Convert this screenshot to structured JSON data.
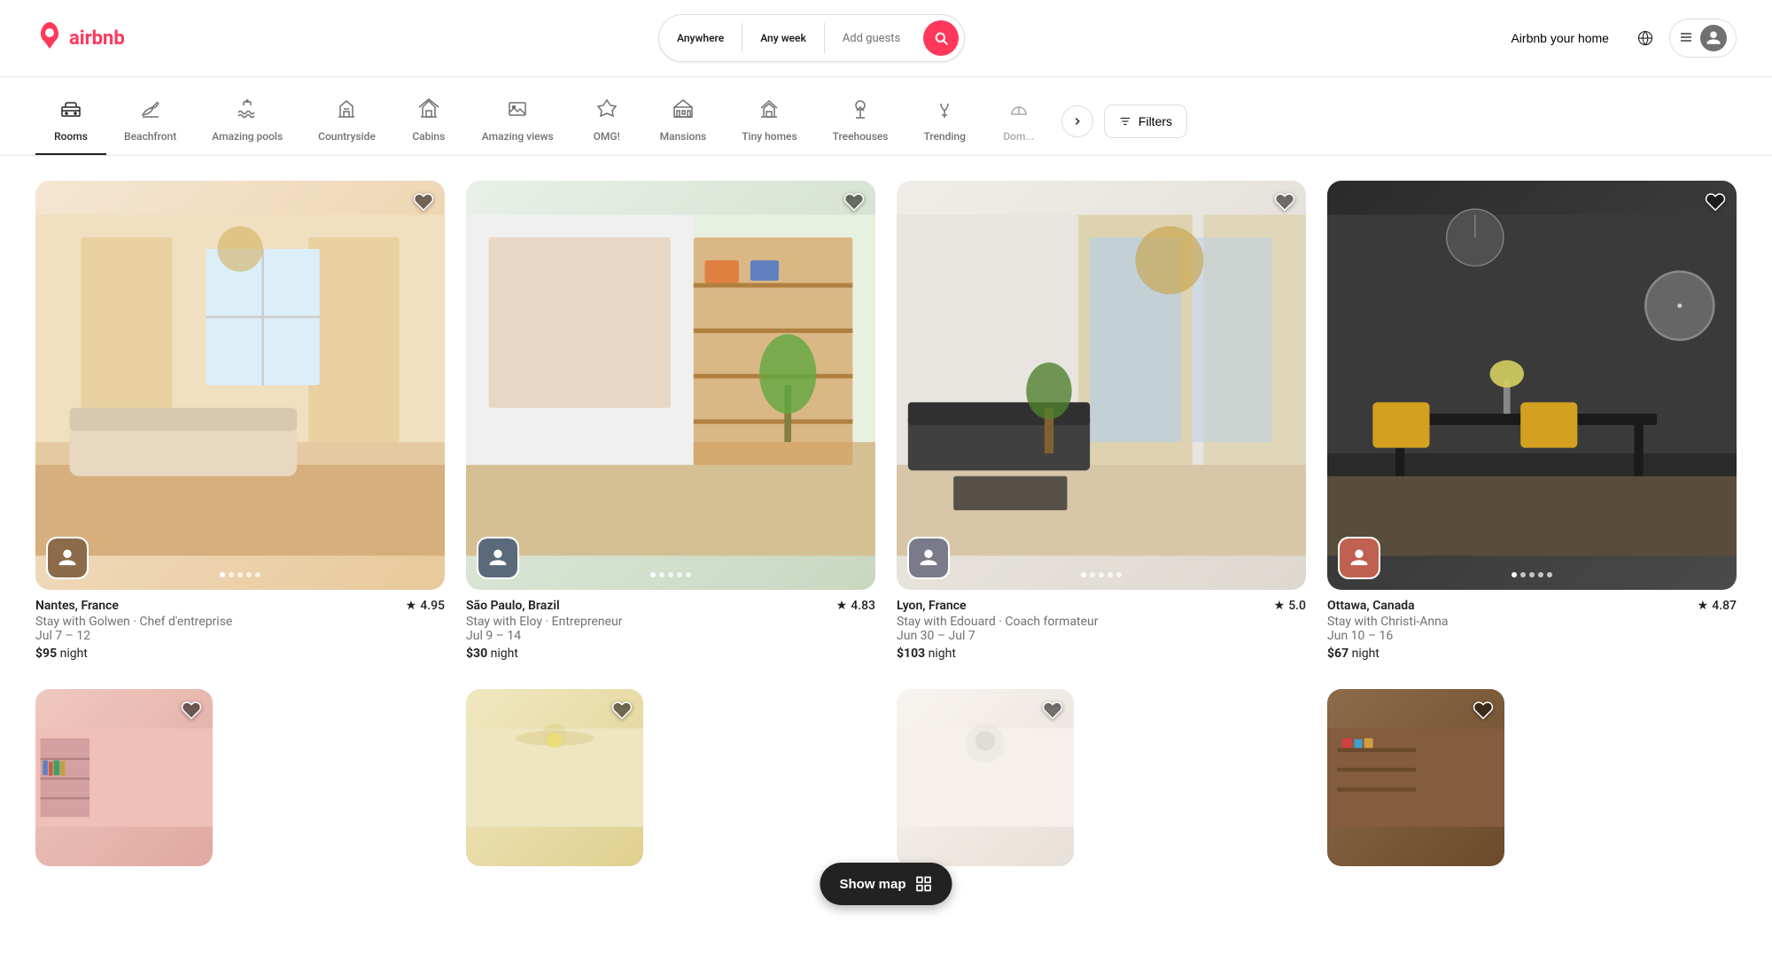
{
  "header": {
    "logo_text": "airbnb",
    "search": {
      "location_label": "Anywhere",
      "week_label": "Any week",
      "guests_placeholder": "Add guests"
    },
    "nav": {
      "host_label": "Airbnb your home",
      "menu_icon": "☰",
      "globe_icon": "🌐"
    }
  },
  "categories": [
    {
      "id": "rooms",
      "label": "Rooms",
      "icon": "🛏",
      "active": true
    },
    {
      "id": "beachfront",
      "label": "Beachfront",
      "icon": "🌴",
      "active": false
    },
    {
      "id": "amazing-pools",
      "label": "Amazing pools",
      "icon": "🌊",
      "active": false
    },
    {
      "id": "countryside",
      "label": "Countryside",
      "icon": "🏡",
      "active": false
    },
    {
      "id": "cabins",
      "label": "Cabins",
      "icon": "🏠",
      "active": false
    },
    {
      "id": "amazing-views",
      "label": "Amazing views",
      "icon": "🖼",
      "active": false
    },
    {
      "id": "omg",
      "label": "OMG!",
      "icon": "🏛",
      "active": false
    },
    {
      "id": "mansions",
      "label": "Mansions",
      "icon": "🏰",
      "active": false
    },
    {
      "id": "tiny-homes",
      "label": "Tiny homes",
      "icon": "🏘",
      "active": false
    },
    {
      "id": "treehouses",
      "label": "Treehouses",
      "icon": "🌲",
      "active": false
    },
    {
      "id": "trending",
      "label": "Trending",
      "icon": "🔥",
      "active": false
    },
    {
      "id": "domes",
      "label": "Domes",
      "icon": "⬡",
      "active": false
    }
  ],
  "filters": {
    "label": "Filters",
    "icon": "⚙"
  },
  "listings": [
    {
      "id": 1,
      "location": "Nantes, France",
      "rating": "4.95",
      "host_desc": "Stay with Golwen · Chef d'entreprise",
      "dates": "Jul 7 – 12",
      "price": "$95",
      "price_unit": "night",
      "bg": "warm",
      "dots": 5
    },
    {
      "id": 2,
      "location": "São Paulo, Brazil",
      "rating": "4.83",
      "host_desc": "Stay with Eloy · Entrepreneur",
      "dates": "Jul 9 – 14",
      "price": "$30",
      "price_unit": "night",
      "bg": "blue",
      "dots": 5
    },
    {
      "id": 3,
      "location": "Lyon, France",
      "rating": "5.0",
      "host_desc": "Stay with Edouard · Coach formateur",
      "dates": "Jun 30 – Jul 7",
      "price": "$103",
      "price_unit": "night",
      "bg": "cream",
      "dots": 5
    },
    {
      "id": 4,
      "location": "Ottawa, Canada",
      "rating": "4.87",
      "host_desc": "Stay with Christi-Anna",
      "dates": "Jun 10 – 16",
      "price": "$67",
      "price_unit": "night",
      "bg": "gray",
      "dots": 5
    }
  ],
  "bottom_row": [
    {
      "id": 5,
      "bg": "pink"
    },
    {
      "id": 6,
      "bg": "yellow"
    },
    {
      "id": 7,
      "bg": "cream"
    },
    {
      "id": 8,
      "bg": "brown"
    }
  ],
  "show_map": {
    "label": "Show map",
    "icon": "⊞"
  }
}
